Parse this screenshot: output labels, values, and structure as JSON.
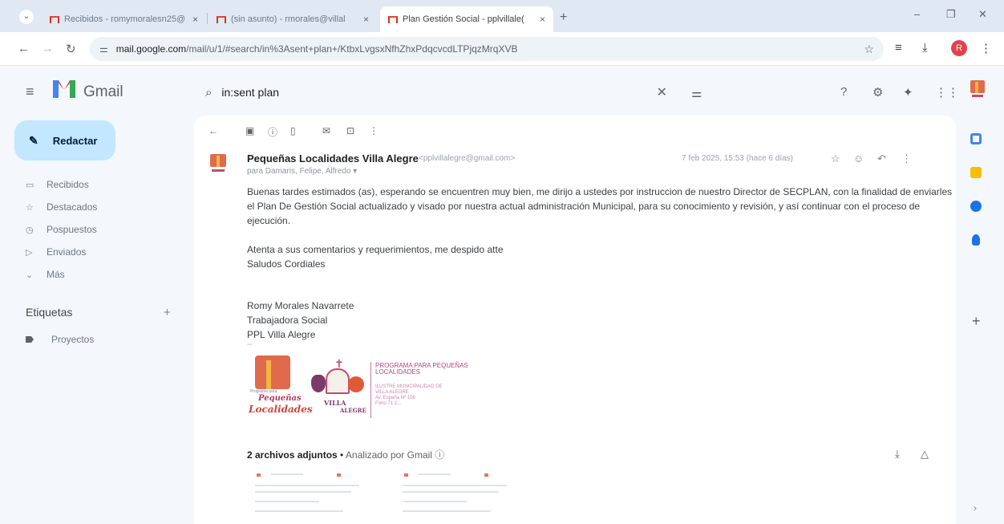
{
  "browser": {
    "tabs": [
      {
        "title": "Recibidos - romymoralesn25@"
      },
      {
        "title": "(sin asunto) - rmorales@villal"
      },
      {
        "title": "Plan Gestión Social - pplvillale("
      }
    ],
    "tab_close": "×",
    "new_tab": "+",
    "url_host": "mail.google.com",
    "url_path": "/mail/u/1/#search/in%3Asent+plan+/KtbxLvgsxNfhZhxPdqcvcdLTPjqzMrqXVB",
    "profile_initial": "R"
  },
  "gmail": {
    "app_name": "Gmail",
    "search_query": "in:sent plan",
    "compose_label": "Redactar",
    "nav": [
      {
        "label": "Recibidos",
        "icon": "inbox-icon"
      },
      {
        "label": "Destacados",
        "icon": "star-icon"
      },
      {
        "label": "Pospuestos",
        "icon": "clock-icon"
      },
      {
        "label": "Enviados",
        "icon": "send-icon"
      },
      {
        "label": "Más",
        "icon": "chevron-down-icon"
      }
    ],
    "labels_header": "Etiquetas",
    "labels": [
      {
        "label": "Proyectos"
      }
    ]
  },
  "message": {
    "sender_name": "Pequeñas Localidades Villa Alegre",
    "sender_email": "<pplvillalegre@gmail.com>",
    "date": "7 feb 2025, 15:53 (hace 6 días)",
    "to_line": "para Damaris, Felipe, Alfredo ▾",
    "body": "Buenas tardes estimados (as), esperando se encuentren muy bien, me dirijo a ustedes por instruccion de nuestro Director de SECPLAN, con la finalidad de enviarles el Plan De Gestión Social actualizado y visado por nuestra actual administración Municipal, para su conocimiento y revisión, y así continuar con el proceso de ejecución.",
    "closing_1": "Atenta a sus comentarios y requerimientos, me despido atte",
    "closing_2": "Saludos Cordiales",
    "sig_name": "Romy Morales Navarrete",
    "sig_role": "Trabajadora Social",
    "sig_org": "PPL Villa Alegre",
    "sig_dash": "--",
    "logo": {
      "pp_small": "Programa para",
      "pp_title_1": "Pequeñas",
      "pp_title_2": "Localidades",
      "va_1": "VILLA",
      "va_2": "ALEGRE",
      "program_1": "PROGRAMA PARA PEQUEÑAS",
      "program_2": "LOCALIDADES",
      "muni_1": "ILUSTRE MUNICIPALIDAD DE",
      "muni_2": "VILLA ALEGRE",
      "muni_3": "Av. España Nº 106",
      "muni_4": "Fono 71 2..."
    },
    "attachments_title": "2 archivos adjuntos",
    "attachments_scan": "Analizado por Gmail ⓘ"
  },
  "colors": {
    "compose_bg": "#c2e7ff",
    "gmail_red": "#ea4335",
    "page_bg": "#f4f7fb"
  }
}
